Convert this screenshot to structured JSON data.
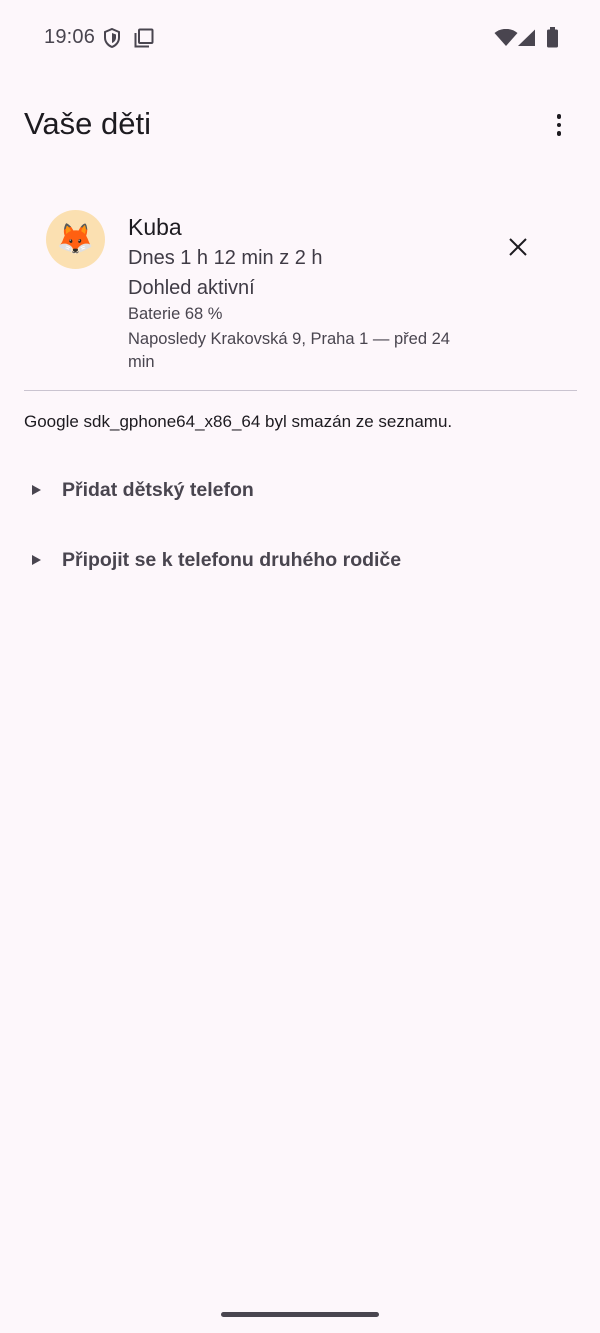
{
  "status_bar": {
    "time": "19:06",
    "icons": [
      "shield-icon",
      "screen-icon",
      "wifi-icon",
      "signal-icon",
      "battery-icon"
    ]
  },
  "header": {
    "title": "Vaše děti",
    "menu_icon": "more-vert-icon"
  },
  "child": {
    "avatar_emoji": "🦊",
    "avatar_bg": "#fbe0b1",
    "name": "Kuba",
    "usage": "Dnes 1 h 12 min z 2 h",
    "supervision": "Dohled aktivní",
    "battery": "Baterie 68 %",
    "location": "Naposledy Krakovská 9, Praha 1 — před 24 min",
    "remove_icon": "close-icon"
  },
  "notice": "Google sdk_gphone64_x86_64 byl smazán ze seznamu.",
  "actions": [
    {
      "label": "Přidat dětský telefon",
      "icon": "expand-arrow-icon"
    },
    {
      "label": "Připojit se k telefonu druhého rodiče",
      "icon": "expand-arrow-icon"
    }
  ],
  "colors": {
    "background": "#fdf7fb",
    "text": "#1d1b20",
    "secondary_text": "#49454f",
    "divider": "#cac4d0"
  }
}
